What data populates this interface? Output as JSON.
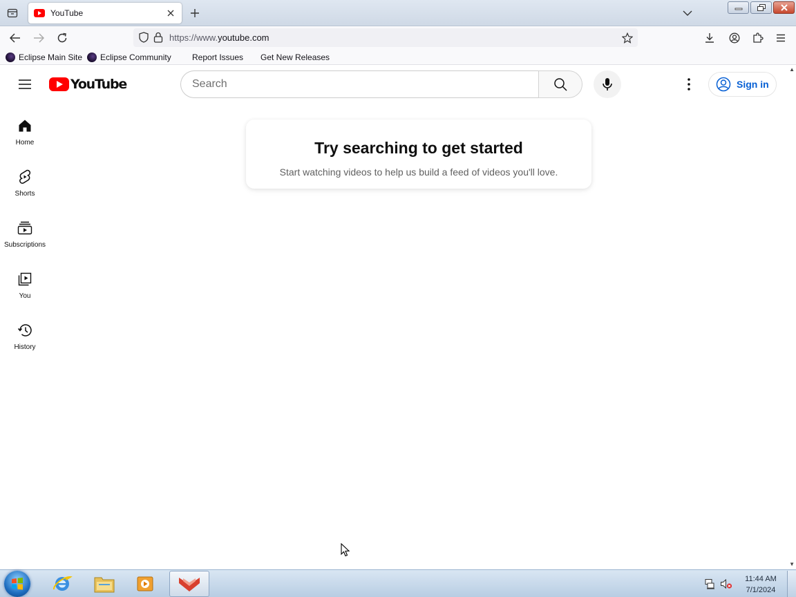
{
  "browser": {
    "tab": {
      "title": "YouTube"
    },
    "url": {
      "prefix": "https://www.",
      "domain": "youtube.com"
    },
    "bookmarks": [
      {
        "label": "Eclipse Main Site"
      },
      {
        "label": "Eclipse Community"
      },
      {
        "label": "Report Issues"
      },
      {
        "label": "Get New Releases"
      }
    ]
  },
  "youtube": {
    "logo_text": "YouTube",
    "search": {
      "placeholder": "Search"
    },
    "signin_label": "Sign in",
    "sidebar": [
      {
        "label": "Home",
        "icon": "home-icon"
      },
      {
        "label": "Shorts",
        "icon": "shorts-icon"
      },
      {
        "label": "Subscriptions",
        "icon": "subscriptions-icon"
      },
      {
        "label": "You",
        "icon": "you-icon"
      },
      {
        "label": "History",
        "icon": "history-icon"
      }
    ],
    "empty_state": {
      "title": "Try searching to get started",
      "subtitle": "Start watching videos to help us build a feed of videos you'll love."
    }
  },
  "taskbar": {
    "time": "11:44 AM",
    "date": "7/1/2024"
  },
  "colors": {
    "youtube_red": "#ff0000",
    "signin_blue": "#065fd4"
  }
}
